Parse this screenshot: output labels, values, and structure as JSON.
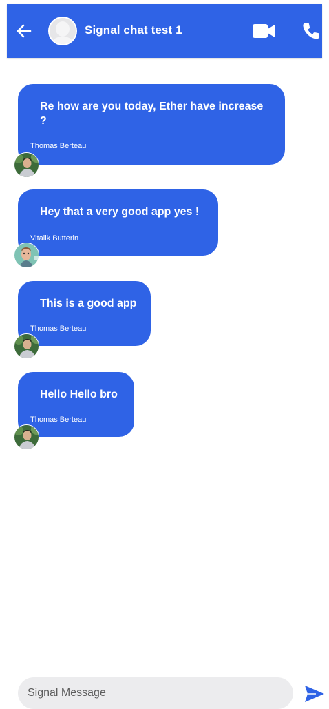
{
  "header": {
    "title": "Signal chat test 1",
    "back_icon": "arrow-left-icon",
    "avatar_icon": "user-avatar-placeholder",
    "video_icon": "video-camera-icon",
    "call_icon": "phone-icon",
    "background_color": "#2f63e6"
  },
  "messages": [
    {
      "text": "Re how are you today, Ether have increase ?",
      "sender": "Thomas Berteau",
      "avatar": "thomas-avatar"
    },
    {
      "text": "Hey that a very good app yes !",
      "sender": "Vitalik Butterin",
      "avatar": "vitalik-avatar"
    },
    {
      "text": "This is a good app",
      "sender": "Thomas Berteau",
      "avatar": "thomas-avatar"
    },
    {
      "text": "Hello Hello bro",
      "sender": "Thomas Berteau",
      "avatar": "thomas-avatar"
    }
  ],
  "composer": {
    "placeholder": "Signal Message",
    "value": "",
    "send_icon": "send-arrow-icon"
  },
  "colors": {
    "accent": "#2f63e6",
    "input_background": "#ececee"
  }
}
